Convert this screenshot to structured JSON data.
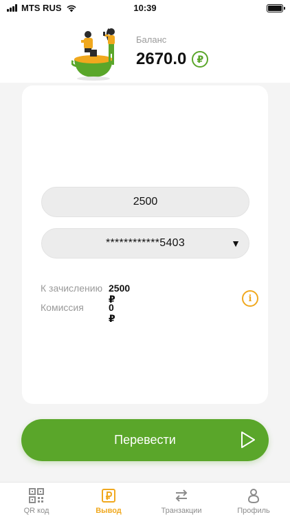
{
  "status_bar": {
    "carrier": "MTS RUS",
    "time": "10:39",
    "signal_icon": "signal-bars-icon",
    "wifi_icon": "wifi-icon",
    "battery_icon": "battery-icon"
  },
  "header": {
    "balance_label": "Баланс",
    "balance_value": "2670.0",
    "currency_symbol": "₽"
  },
  "form": {
    "amount_value": "2500",
    "card_value": "************5403",
    "details": {
      "credit_label": "К зачислению",
      "credit_value": "2500 ₽",
      "fee_label": "Комиссия",
      "fee_value": "0 ₽"
    },
    "info_symbol": "i"
  },
  "transfer_button": {
    "label": "Перевести"
  },
  "tabs": [
    {
      "label": "QR код",
      "icon": "qr-code-icon",
      "active": false
    },
    {
      "label": "Вывод",
      "icon": "ruble-wallet-icon",
      "active": true
    },
    {
      "label": "Транзакции",
      "icon": "transfer-arrows-icon",
      "active": false
    },
    {
      "label": "Профиль",
      "icon": "person-icon",
      "active": false
    }
  ],
  "colors": {
    "accent_green": "#5aa62a",
    "accent_orange": "#f0a81e",
    "background": "#f4f4f4"
  }
}
